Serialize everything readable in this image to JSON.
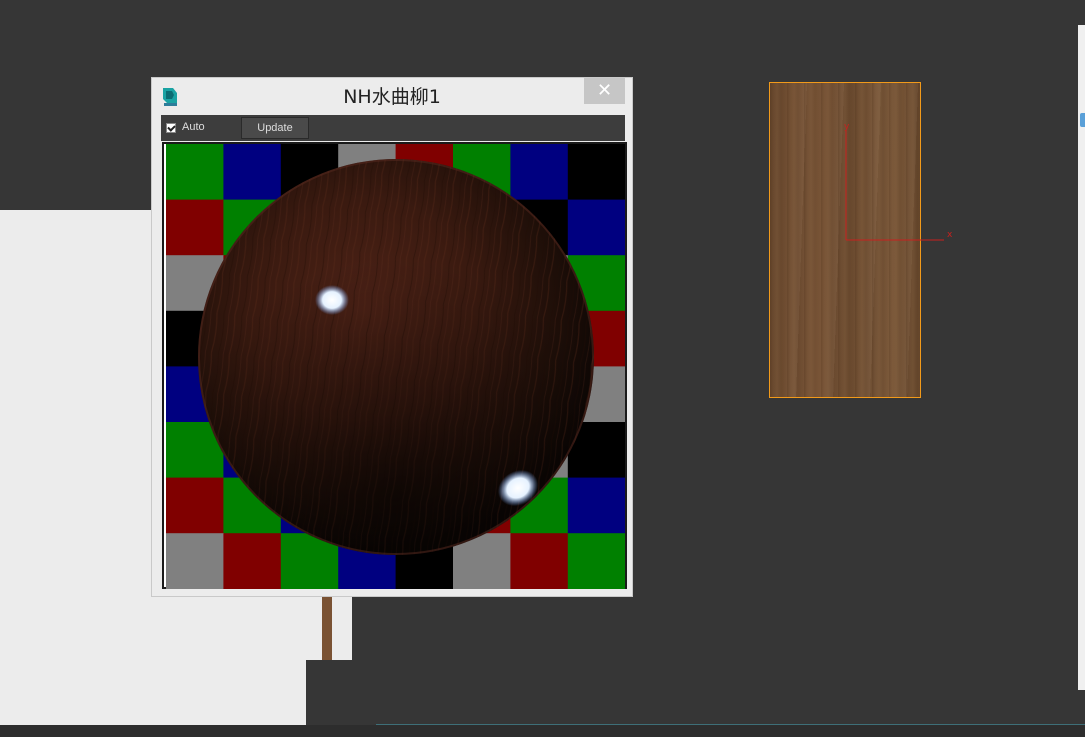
{
  "material_editor": {
    "title": "NH水曲柳1",
    "close_label": "✕",
    "auto_label": "Auto",
    "auto_checked": true,
    "update_label": "Update",
    "icon": "3ds-max-app-icon"
  },
  "viewport": {
    "axis_x_label": "x",
    "axis_y_label": "y"
  },
  "colors": {
    "checker_green": "#008000",
    "checker_blue": "#000080",
    "checker_red": "#800000",
    "checker_gray": "#808080",
    "checker_black": "#000000",
    "selection_orange": "#f29a1a",
    "gizmo_red": "#c8201e"
  }
}
